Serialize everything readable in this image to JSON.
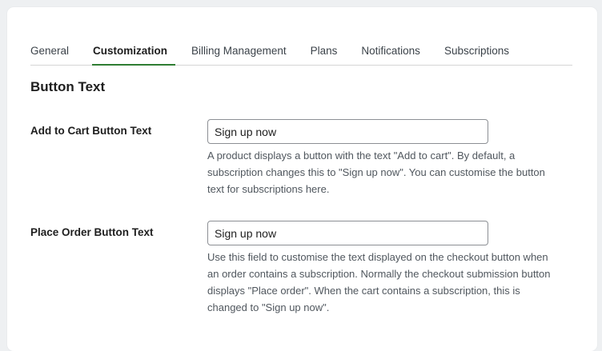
{
  "tabs": [
    {
      "label": "General",
      "active": false
    },
    {
      "label": "Customization",
      "active": true
    },
    {
      "label": "Billing Management",
      "active": false
    },
    {
      "label": "Plans",
      "active": false
    },
    {
      "label": "Notifications",
      "active": false
    },
    {
      "label": "Subscriptions",
      "active": false
    }
  ],
  "section": {
    "title": "Button Text"
  },
  "fields": {
    "add_to_cart": {
      "label": "Add to Cart Button Text",
      "value": "Sign up now",
      "help": "A product displays a button with the text \"Add to cart\". By default, a subscription changes this to \"Sign up now\". You can customise the button text for subscriptions here."
    },
    "place_order": {
      "label": "Place Order Button Text",
      "value": "Sign up now",
      "help": "Use this field to customise the text displayed on the checkout button when an order contains a subscription. Normally the checkout submission button displays \"Place order\". When the cart contains a subscription, this is changed to \"Sign up now\"."
    }
  },
  "colors": {
    "active_tab_underline": "#2e7d32",
    "page_background": "#eef0f2"
  }
}
